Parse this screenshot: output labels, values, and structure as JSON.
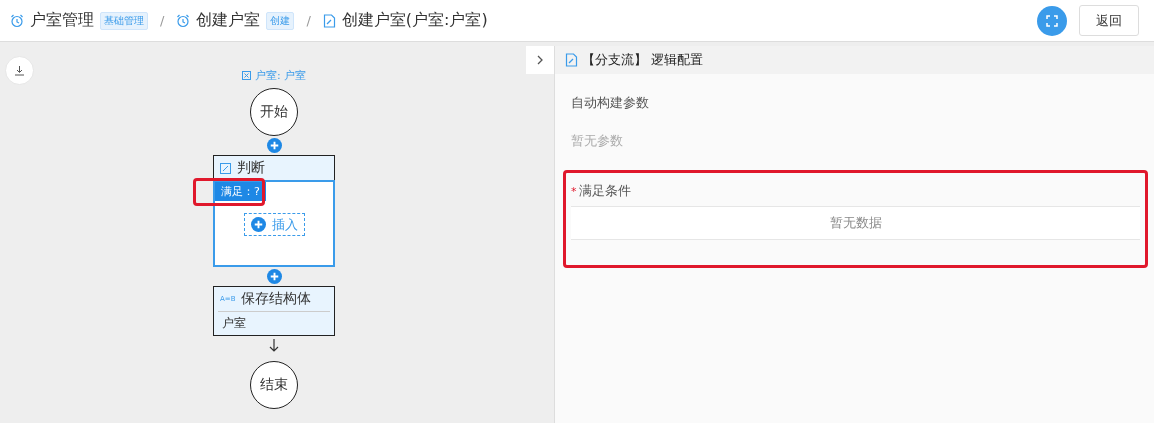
{
  "breadcrumb": [
    {
      "label": "户室管理",
      "tag": "基础管理"
    },
    {
      "separator": "/",
      "label": "创建户室",
      "tag": "创建"
    },
    {
      "separator": "/",
      "label": "创建户室(户室:户室)"
    }
  ],
  "actions": {
    "back": "返回"
  },
  "flow": {
    "context": "户室: 户室",
    "nodes": [
      {
        "kind": "terminal",
        "label": "开始"
      },
      {
        "kind": "add"
      },
      {
        "kind": "condition",
        "title": "判断",
        "branch": "满足：?",
        "insert": "插入",
        "highlighted": true
      },
      {
        "kind": "add"
      },
      {
        "kind": "action",
        "icon_text": "A=B",
        "title": "保存结构体",
        "body": "户室"
      },
      {
        "kind": "arrow"
      },
      {
        "kind": "terminal",
        "label": "结束"
      }
    ]
  },
  "panel": {
    "title": "【分支流】 逻辑配置",
    "params_label": "自动构建参数",
    "params_empty": "暂无参数",
    "condition": {
      "label": "满足条件",
      "required_mark": "*",
      "empty": "暂无数据",
      "highlighted": true
    }
  }
}
